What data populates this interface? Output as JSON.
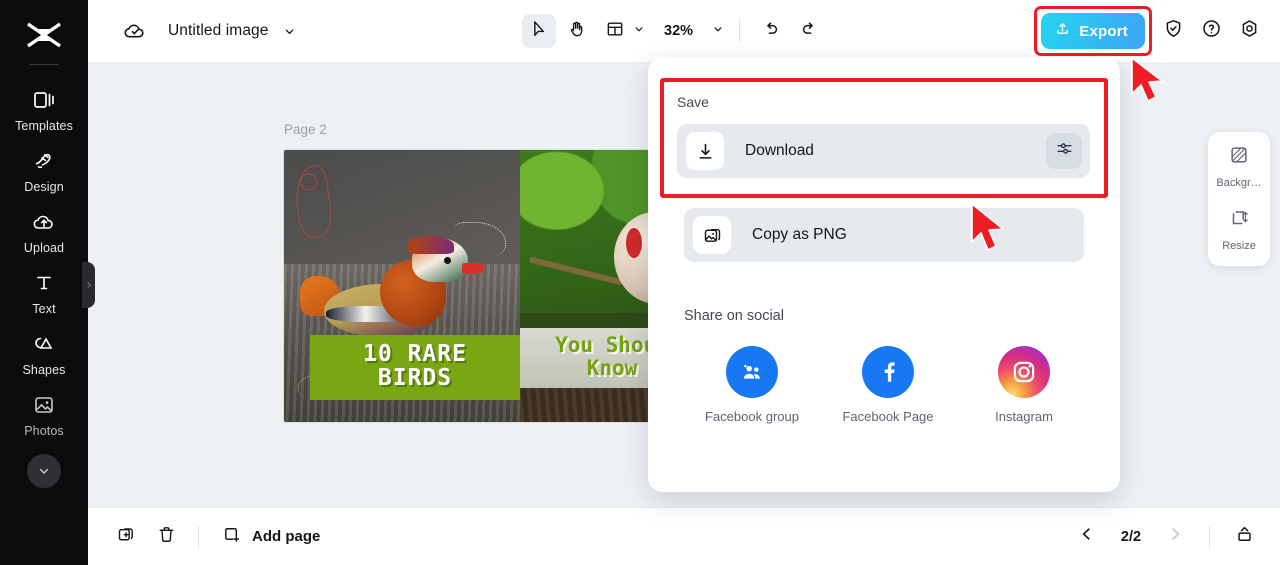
{
  "sidebar": {
    "logo_icon": "capcut-logo-icon",
    "items": [
      {
        "label": "Templates",
        "icon": "templates-icon"
      },
      {
        "label": "Design",
        "icon": "design-brush-icon"
      },
      {
        "label": "Upload",
        "icon": "upload-cloud-icon"
      },
      {
        "label": "Text",
        "icon": "text-t-icon"
      },
      {
        "label": "Shapes",
        "icon": "shapes-icon"
      },
      {
        "label": "Photos",
        "icon": "photos-image-icon"
      }
    ],
    "collapse_icon": "chevron-down-icon",
    "handle_icon": "chevron-right-icon"
  },
  "topbar": {
    "cloud_icon": "cloud-saved-icon",
    "doc_title": "Untitled image",
    "title_caret_icon": "chevron-down-icon",
    "tools": [
      {
        "name": "select-tool",
        "icon": "cursor-arrow-icon",
        "active": true
      },
      {
        "name": "hand-tool",
        "icon": "hand-icon",
        "active": false
      },
      {
        "name": "layout-tool",
        "icon": "layout-panel-icon",
        "active": false
      }
    ],
    "layout_caret_icon": "chevron-down-icon",
    "zoom_level": "32%",
    "zoom_caret_icon": "chevron-down-icon",
    "undo_icon": "undo-arrow-icon",
    "redo_icon": "redo-arrow-icon",
    "export_label": "Export",
    "export_icon": "export-upload-icon",
    "export_color_start": "#26d4f0",
    "export_color_end": "#3da4f2",
    "highlight_color": "#ee1d24",
    "right_icons": [
      {
        "name": "shield-check-icon"
      },
      {
        "name": "help-question-icon"
      },
      {
        "name": "settings-gear-icon"
      }
    ]
  },
  "canvas": {
    "page_label": "Page 2",
    "background_color": "#eef1f4",
    "design": {
      "left_tile_title_line1": "10 RARE",
      "left_tile_title_line2": "BIRDS",
      "left_tile_band_color": "#7aa614",
      "right_tile_title_line1": "You Shoul",
      "right_tile_title_line2": "Know",
      "right_tile_text_color": "#74a30f",
      "left_subject": "mandarin-duck-photo",
      "right_subject": "small-bird-photo"
    }
  },
  "right_panel": {
    "items": [
      {
        "label": "Backgr…",
        "icon": "background-pattern-icon"
      },
      {
        "label": "Resize",
        "icon": "resize-icon"
      }
    ]
  },
  "export_dropdown": {
    "save_section_title": "Save",
    "download_label": "Download",
    "download_icon": "download-arrow-icon",
    "download_settings_icon": "sliders-settings-icon",
    "copy_png_label": "Copy as PNG",
    "copy_png_icon": "copy-image-icon",
    "share_section_title": "Share on social",
    "socials": [
      {
        "label": "Facebook group",
        "icon": "facebook-group-icon",
        "color": "#1877f2"
      },
      {
        "label": "Facebook Page",
        "icon": "facebook-page-icon",
        "color": "#1877f2"
      },
      {
        "label": "Instagram",
        "icon": "instagram-icon",
        "color": "#d62e7f"
      }
    ]
  },
  "bottombar": {
    "duplicate_icon": "duplicate-page-icon",
    "delete_icon": "trash-delete-icon",
    "add_page_label": "Add page",
    "add_page_icon": "add-page-icon",
    "prev_icon": "chevron-left-icon",
    "next_icon": "chevron-right-icon",
    "page_indicator": "2/2",
    "grid_view_icon": "page-grid-icon"
  },
  "annotations": {
    "arrow_color": "#ee1d24",
    "arrows": [
      "arrow-pointing-to-export-button",
      "arrow-pointing-to-download-row"
    ]
  }
}
